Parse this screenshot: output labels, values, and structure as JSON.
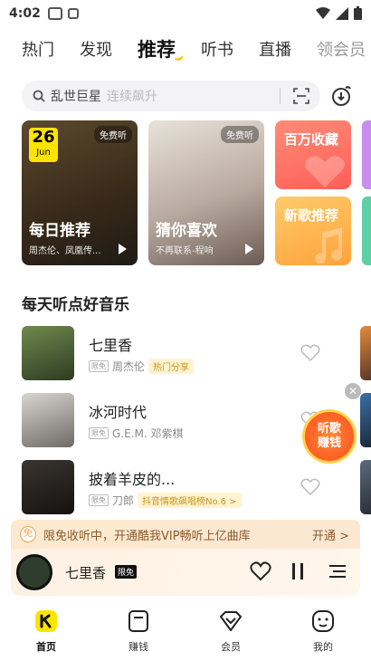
{
  "status_bar": {
    "time": "4:02"
  },
  "top_tabs": [
    {
      "label": "热门",
      "active": false
    },
    {
      "label": "发现",
      "active": false
    },
    {
      "label": "推荐",
      "active": true
    },
    {
      "label": "听书",
      "active": false
    },
    {
      "label": "直播",
      "active": false
    },
    {
      "label": "领会员",
      "active": false
    }
  ],
  "search": {
    "query": "乱世巨星",
    "hint": "连续飙升"
  },
  "banners": {
    "daily": {
      "day": "26",
      "month": "Jun",
      "tag": "免费听",
      "title": "每日推荐",
      "subtitle": "周杰伦、凤凰传..."
    },
    "guess": {
      "tag": "免费听",
      "title": "猜你喜欢",
      "subtitle": "不再联系-程响"
    },
    "small": [
      {
        "title": "百万收藏"
      },
      {
        "title": "新歌推荐"
      }
    ]
  },
  "section_title": "每天听点好音乐",
  "songs": [
    {
      "title": "七里香",
      "badge": "限免",
      "artist": "周杰伦",
      "tag": "热门分享"
    },
    {
      "title": "冰河时代",
      "badge": "限免",
      "artist": "G.E.M. 邓紫棋",
      "tag": ""
    },
    {
      "title": "披着羊皮的...",
      "badge": "限免",
      "artist": "刀郎",
      "tag": "抖音情歌飙唱榜No.6 >"
    }
  ],
  "float_widget": {
    "line1": "听歌",
    "line2": "赚钱"
  },
  "vip_banner": {
    "icon": "免",
    "text": "限免收听中，开通酷我VIP畅听上亿曲库",
    "action": "开通 >"
  },
  "player": {
    "title": "七里香",
    "badge": "限免"
  },
  "bottom_nav": [
    {
      "label": "首页",
      "icon": "home-icon",
      "active": true
    },
    {
      "label": "赚钱",
      "icon": "wallet-icon",
      "active": false
    },
    {
      "label": "会员",
      "icon": "diamond-icon",
      "active": false
    },
    {
      "label": "我的",
      "icon": "profile-icon",
      "active": false
    }
  ],
  "colors": {
    "brand_yellow": "#ffe400",
    "accent_gold": "#f5c400",
    "vip_text": "#8a5a2a"
  }
}
